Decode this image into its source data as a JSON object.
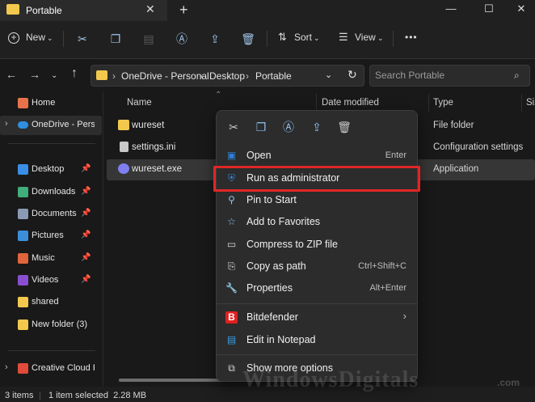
{
  "window": {
    "tab_title": "Portable",
    "tab_close": "✕",
    "new_tab": "+",
    "minimize": "—",
    "maximize": "☐",
    "close": "✕"
  },
  "toolbar": {
    "new_label": "New",
    "sort_label": "Sort",
    "view_label": "View",
    "more": "•••"
  },
  "address": {
    "breadcrumbs": [
      "OneDrive - Personal",
      "Desktop",
      "Portable"
    ],
    "search_placeholder": "Search Portable"
  },
  "sidebar": {
    "items": [
      {
        "label": "Home",
        "icon": "home-icon",
        "color": "#e8734a"
      },
      {
        "label": "OneDrive - Persona",
        "icon": "cloud-icon",
        "color": "#2f8fe0"
      },
      {
        "label": "Desktop",
        "icon": "desktop-icon",
        "color": "#3a8ee6",
        "pinned": true
      },
      {
        "label": "Downloads",
        "icon": "download-icon",
        "color": "#3fae7a",
        "pinned": true
      },
      {
        "label": "Documents",
        "icon": "documents-icon",
        "color": "#8a9bb5",
        "pinned": true
      },
      {
        "label": "Pictures",
        "icon": "pictures-icon",
        "color": "#3b8ed8",
        "pinned": true
      },
      {
        "label": "Music",
        "icon": "music-icon",
        "color": "#e0643c",
        "pinned": true
      },
      {
        "label": "Videos",
        "icon": "videos-icon",
        "color": "#8a4fd1",
        "pinned": true
      },
      {
        "label": "shared",
        "icon": "folder-icon",
        "color": "#f2c94c"
      },
      {
        "label": "New folder (3)",
        "icon": "folder-icon",
        "color": "#f2c94c"
      },
      {
        "label": "Creative Cloud F",
        "icon": "creative-cloud-icon",
        "color": "#e04b3a"
      }
    ],
    "pin_glyph": "📌"
  },
  "columns": {
    "name": "Name",
    "date_modified": "Date modified",
    "type": "Type",
    "size": "Siz"
  },
  "files": [
    {
      "name": "wureset",
      "type": "File folder",
      "icon": "folder-icon",
      "color": "#f2c94c"
    },
    {
      "name": "settings.ini",
      "type": "Configuration settings",
      "icon": "settings-file-icon",
      "color": "#c8c8c8"
    },
    {
      "name": "wureset.exe",
      "type": "Application",
      "icon": "application-icon",
      "color": "#7f7ff0",
      "selected": true
    }
  ],
  "context_menu": {
    "quick_actions": [
      "cut-icon",
      "copy-icon",
      "rename-icon",
      "share-icon",
      "delete-icon"
    ],
    "items": [
      {
        "label": "Open",
        "shortcut": "Enter",
        "icon": "open-icon",
        "color": "#2f7fd6"
      },
      {
        "label": "Run as administrator",
        "shortcut": "",
        "icon": "run-as-admin-icon",
        "color": "#3a86d8"
      },
      {
        "label": "Pin to Start",
        "shortcut": "",
        "icon": "pin-icon",
        "color": "#8fc0ee"
      },
      {
        "label": "Add to Favorites",
        "shortcut": "",
        "icon": "star-icon",
        "color": "#8fc0ee"
      },
      {
        "label": "Compress to ZIP file",
        "shortcut": "",
        "icon": "zip-icon",
        "color": "#d9d9d9"
      },
      {
        "label": "Copy as path",
        "shortcut": "Ctrl+Shift+C",
        "icon": "copy-path-icon",
        "color": "#d9d9d9"
      },
      {
        "label": "Properties",
        "shortcut": "Alt+Enter",
        "icon": "properties-icon",
        "color": "#d9d9d9"
      },
      {
        "label": "Bitdefender",
        "shortcut": "",
        "icon": "bitdefender-icon",
        "color": "#e02020",
        "submenu": true
      },
      {
        "label": "Edit in Notepad",
        "shortcut": "",
        "icon": "notepad-icon",
        "color": "#3aa0e6"
      },
      {
        "label": "Show more options",
        "shortcut": "",
        "icon": "more-options-icon",
        "color": "#d9d9d9"
      }
    ],
    "highlight_color": "#e02626"
  },
  "status": {
    "item_count": "3 items",
    "selection": "1 item selected  2.28 MB"
  },
  "watermark": {
    "text": "WindowsDigitals",
    "suffix": ".com"
  }
}
